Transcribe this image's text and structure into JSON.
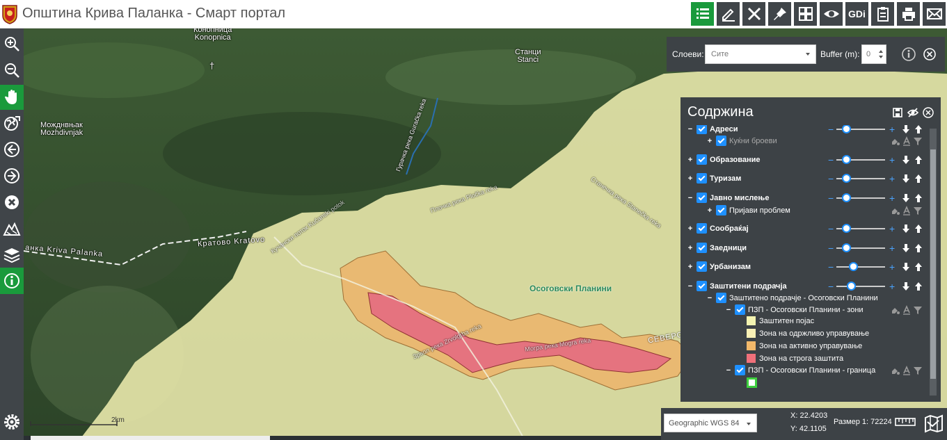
{
  "header": {
    "title": "Општина Крива Паланка - Смарт портал",
    "toolbar": [
      {
        "name": "list",
        "icon": "list-icon",
        "active": true
      },
      {
        "name": "edit",
        "icon": "pencil-icon"
      },
      {
        "name": "measure",
        "icon": "measure-icon"
      },
      {
        "name": "pin",
        "icon": "pin-icon"
      },
      {
        "name": "layout",
        "icon": "layout-icon"
      },
      {
        "name": "view",
        "icon": "eye-icon"
      },
      {
        "name": "gdi",
        "label": "GDi"
      },
      {
        "name": "clipboard",
        "icon": "clipboard-icon"
      },
      {
        "name": "print",
        "icon": "printer-icon"
      },
      {
        "name": "email",
        "icon": "envelope-icon"
      }
    ]
  },
  "sidebar": [
    "zoom-in-icon",
    "zoom-out-icon",
    "pan-hand-icon",
    "globe-icon",
    "back-icon",
    "forward-icon",
    "clear-icon",
    "terrain-icon",
    "layers-icon",
    "info-icon",
    "settings-icon"
  ],
  "map": {
    "labels": {
      "konopnica": "Конопница\nKonopnica",
      "stanci": "Станци\nStanci",
      "mozdivnjak": "Можднвњак\nMozhdivnjak",
      "kriva_palanka": "анка Kriva Palanka",
      "kratovo": "Кратово Kratovo",
      "osogovski": "Осоговски Планини",
      "severo": "СЕВЕРО",
      "guracka": "Гурачка река Guračka reka",
      "plocka": "Плочка река Pločka reka",
      "kucanski": "Кучански поток Kučanski potok",
      "stanecka": "Станечка река Stanečka reka",
      "mogra": "Могра река Mogra reka",
      "zrvolgrba": "Зрвол река Zrvolgrba reka"
    },
    "scalebar": "2km"
  },
  "layerbar": {
    "layers_label": "Слоеви:",
    "layers_value": "Сите",
    "buffer_label": "Buffer (m):",
    "buffer_value": "0"
  },
  "content_panel": {
    "title": "Содржина",
    "rows": [
      {
        "label": "Адреси",
        "toggle": "−",
        "level": 0,
        "slider": 0.15
      },
      {
        "label": "Куќни броеви",
        "toggle": "+",
        "level": 1,
        "dim": true
      },
      {
        "label": "Образование",
        "toggle": "+",
        "level": 0,
        "slider": 0.15
      },
      {
        "label": "Туризам",
        "toggle": "+",
        "level": 0,
        "slider": 0.15
      },
      {
        "label": "Јавно мислење",
        "toggle": "−",
        "level": 0,
        "slider": 0.15
      },
      {
        "label": "Пријави проблем",
        "toggle": "+",
        "level": 1
      },
      {
        "label": "Сообраќај",
        "toggle": "+",
        "level": 0,
        "slider": 0.15
      },
      {
        "label": "Заедници",
        "toggle": "+",
        "level": 0,
        "slider": 0.15
      },
      {
        "label": "Урбанизам",
        "toggle": "+",
        "level": 0,
        "slider": 0.3
      },
      {
        "label": "Заштитени подрачја",
        "toggle": "−",
        "level": 0,
        "slider": 0.25
      },
      {
        "label": "Заштитено подрачје - Осоговски Планини",
        "toggle": "−",
        "level": 1
      },
      {
        "label": "ПЗП - Осоговски Планини - зони",
        "toggle": "−",
        "level": 2
      },
      {
        "label": "Заштитен појас",
        "swatch": "#f3f3b0",
        "level": 3
      },
      {
        "label": "Зона на одржливо управување",
        "swatch": "#f9f0b5",
        "level": 3
      },
      {
        "label": "Зона на активно управување",
        "swatch": "#f2b86a",
        "level": 3
      },
      {
        "label": "Зона на строга заштита",
        "swatch": "#f0707a",
        "level": 3
      },
      {
        "label": "ПЗП - Осоговски Планини - граница",
        "toggle": "−",
        "level": 2
      },
      {
        "label": "",
        "swatch": "#ffffff",
        "swatch_border": "#3ecf3e",
        "level": 3
      }
    ]
  },
  "bottombar": {
    "crs": "Geographic WGS 84",
    "x": "X: 22.4203",
    "y": "Y: 42.1105",
    "scale": "Размер 1: 72224"
  },
  "colors": {
    "toolbar_bg": "#404549",
    "active_green": "#1a9a3c",
    "panel_bg": "#3d4246",
    "checkbox": "#1e90ff"
  }
}
